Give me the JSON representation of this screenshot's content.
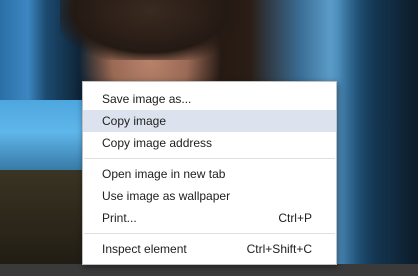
{
  "context_menu": {
    "groups": [
      {
        "items": [
          {
            "label": "Save image as...",
            "shortcut": ""
          },
          {
            "label": "Copy image",
            "shortcut": "",
            "highlighted": true
          },
          {
            "label": "Copy image address",
            "shortcut": ""
          }
        ]
      },
      {
        "items": [
          {
            "label": "Open image in new tab",
            "shortcut": ""
          },
          {
            "label": "Use image as wallpaper",
            "shortcut": ""
          },
          {
            "label": "Print...",
            "shortcut": "Ctrl+P"
          }
        ]
      },
      {
        "items": [
          {
            "label": "Inspect element",
            "shortcut": "Ctrl+Shift+C"
          }
        ]
      }
    ]
  },
  "colors": {
    "highlight": "#dde3ee",
    "menu_background": "#ffffff",
    "text": "#202020"
  }
}
